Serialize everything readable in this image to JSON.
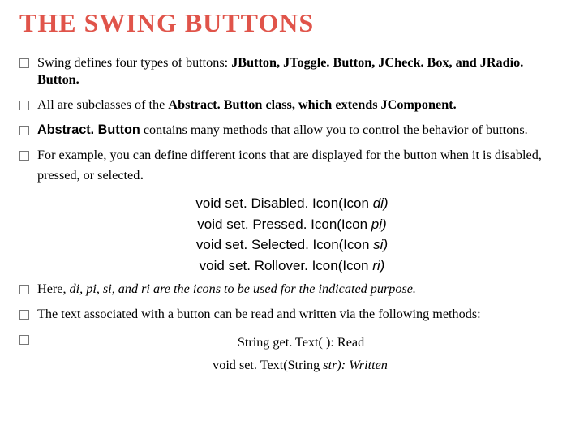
{
  "title": "THE SWING BUTTONS",
  "bullets": {
    "b1a": "Swing defines four types of buttons: ",
    "b1b": "JButton, JToggle. Button, JCheck. Box, and JRadio. Button.",
    "b2a": "All are subclasses of the ",
    "b2b": "Abstract. Button class, which extends JComponent.",
    "b3a": "Abstract. Button",
    "b3b": " contains many methods that allow you to control the behavior of buttons.",
    "b4": "For example, you can define different icons that are displayed for the button when it is disabled, pressed, or selected",
    "b4dot": ".",
    "b5a": "Here, ",
    "b5b": "di, pi, si, and ri are the icons to be used for the indicated purpose.",
    "b6": "The text associated with a button can be read and written via the following methods:"
  },
  "methods": {
    "m1a": "void set. Disabled. Icon(Icon ",
    "m1b": "di)",
    "m2a": "void set. Pressed. Icon(Icon ",
    "m2b": "pi)",
    "m3a": "void set. Selected. Icon(Icon ",
    "m3b": "si)",
    "m4a": "void set. Rollover. Icon(Icon ",
    "m4b": "ri)"
  },
  "tail": {
    "t1": "String get. Text( ):  Read",
    "t2a": "void set. Text(String ",
    "t2b": "str): Written"
  }
}
